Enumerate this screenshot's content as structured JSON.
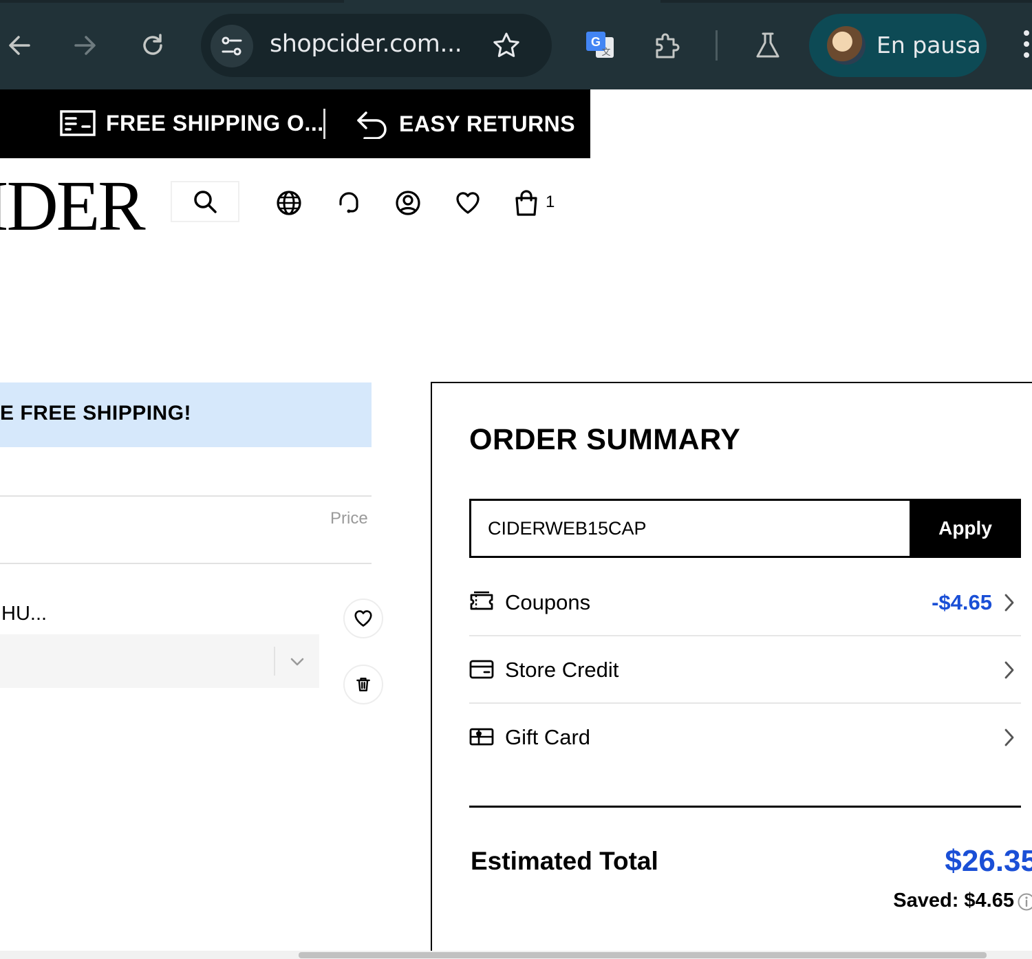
{
  "browser": {
    "url": "shopcider.com...",
    "profile_label": "En pausa",
    "colors": {
      "toolbar": "#213238",
      "omnibox": "#17252a",
      "profile_pill": "#0d4a55"
    },
    "icons": [
      "back-arrow-icon",
      "forward-arrow-icon",
      "reload-icon",
      "site-settings-icon",
      "bookmark-star-icon",
      "google-translate-icon",
      "extensions-icon",
      "labs-flask-icon",
      "menu-dots-icon"
    ]
  },
  "promo": {
    "shipping": "FREE SHIPPING O...",
    "returns": "EASY RETURNS"
  },
  "header": {
    "logo": "IDER",
    "cart_count": "1",
    "icons": [
      "search-icon",
      "globe-icon",
      "support-headset-icon",
      "account-icon",
      "wishlist-heart-icon",
      "shopping-bag-icon"
    ]
  },
  "cart": {
    "shipping_banner": "E FREE SHIPPING!",
    "price_header": "Price",
    "item_title": "HU...",
    "colors": {
      "banner": "#d6e8fb"
    }
  },
  "summary": {
    "title": "ORDER SUMMARY",
    "coupon_code": "CIDERWEB15CAP",
    "apply_label": "Apply",
    "rows": [
      {
        "label": "Coupons",
        "value": "-$4.65",
        "icon": "coupon-ticket-icon"
      },
      {
        "label": "Store Credit",
        "value": "",
        "icon": "store-credit-card-icon"
      },
      {
        "label": "Gift Card",
        "value": "",
        "icon": "gift-card-icon"
      }
    ],
    "total_label": "Estimated Total",
    "total_value": "$26.35",
    "saved": "Saved: $4.65",
    "colors": {
      "accent_blue": "#1a4fd6"
    }
  }
}
